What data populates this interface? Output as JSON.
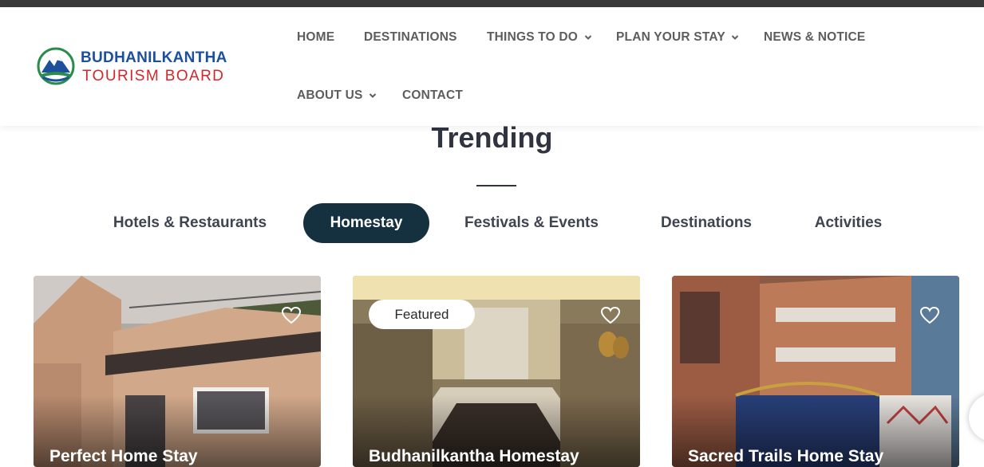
{
  "brand": {
    "line1": "BUDHANILKANTHA",
    "line2": "TOURISM BOARD",
    "primary_color": "#1c4f9c",
    "accent_color": "#d4262b"
  },
  "nav": {
    "home": "HOME",
    "destinations": "DESTINATIONS",
    "things_to_do": "THINGS TO DO",
    "plan_your_stay": "PLAN YOUR STAY",
    "news_notice": "NEWS & NOTICE",
    "about_us": "ABOUT US",
    "contact": "CONTACT"
  },
  "section": {
    "title": "Trending"
  },
  "tabs": [
    {
      "label": "Hotels & Restaurants",
      "active": false
    },
    {
      "label": "Homestay",
      "active": true
    },
    {
      "label": "Festivals & Events",
      "active": false
    },
    {
      "label": "Destinations",
      "active": false
    },
    {
      "label": "Activities",
      "active": false
    }
  ],
  "cards": [
    {
      "title": "Perfect Home Stay",
      "badge": "",
      "icon": "heart-icon"
    },
    {
      "title": "Budhanilkantha Homestay",
      "badge": "Featured",
      "icon": "heart-icon"
    },
    {
      "title": "Sacred Trails Home Stay",
      "badge": "",
      "icon": "heart-icon"
    }
  ],
  "colors": {
    "active_tab_bg": "#15303e",
    "heading": "#2f3440",
    "nav_text": "#5d5d5d"
  }
}
